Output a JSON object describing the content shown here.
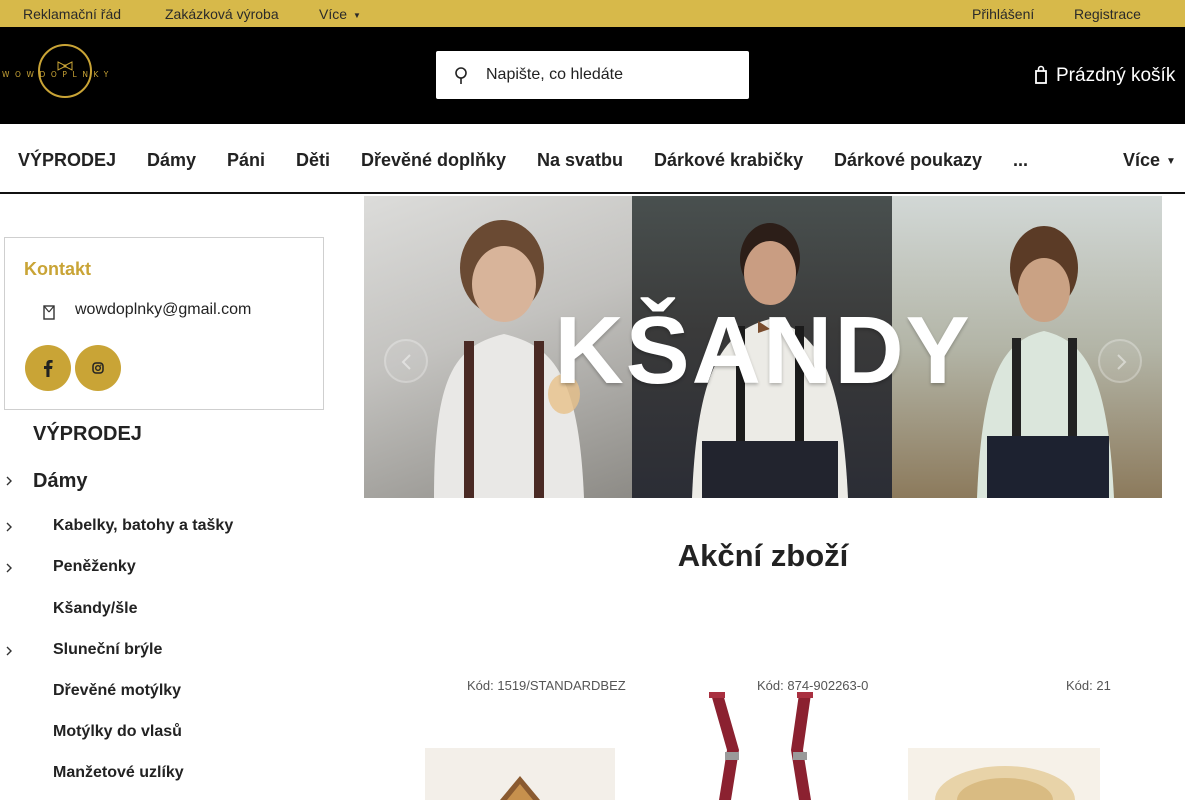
{
  "topbar": {
    "links": [
      "Reklamační řád",
      "Zakázková výroba",
      "Více"
    ],
    "account": [
      "Přihlášení",
      "Registrace"
    ]
  },
  "header": {
    "logo_text": "WOWDOPLNKY",
    "search_placeholder": "Napište, co hledáte",
    "cart_label": "Prázdný košík"
  },
  "nav": {
    "items": [
      "VÝPRODEJ",
      "Dámy",
      "Páni",
      "Děti",
      "Dřevěné doplňky",
      "Na svatbu",
      "Dárkové krabičky",
      "Dárkové poukazy",
      "...",
      "Více"
    ]
  },
  "sidebar": {
    "contact_title": "Kontakt",
    "email": "wowdoplnky@gmail.com",
    "categories": [
      {
        "label": "VÝPRODEJ",
        "expandable": false
      },
      {
        "label": "Dámy",
        "expandable": true
      },
      {
        "label": "Kabelky, batohy a tašky",
        "expandable": true
      },
      {
        "label": "Peněženky",
        "expandable": true
      },
      {
        "label": "Kšandy/šle",
        "expandable": false
      },
      {
        "label": "Sluneční brýle",
        "expandable": true
      },
      {
        "label": "Dřevěné motýlky",
        "expandable": false
      },
      {
        "label": "Motýlky do vlasů",
        "expandable": false
      },
      {
        "label": "Manžetové uzlíky",
        "expandable": false
      }
    ]
  },
  "banner": {
    "title": "KŠANDY"
  },
  "products": {
    "section_title": "Akční zboží",
    "codes": [
      "Kód: 1519/STANDARDBEZ",
      "Kód: 874-902263-0",
      "Kód: 21"
    ]
  },
  "colors": {
    "accent": "#d7b94a",
    "gold": "#c9a436",
    "header_bg": "#000000",
    "suspender_red": "#8b2130"
  },
  "icons": [
    "search-icon",
    "cart-icon",
    "mail-icon",
    "facebook-icon",
    "instagram-icon",
    "chevron-left-icon",
    "chevron-right-icon",
    "chevron-down-icon"
  ]
}
